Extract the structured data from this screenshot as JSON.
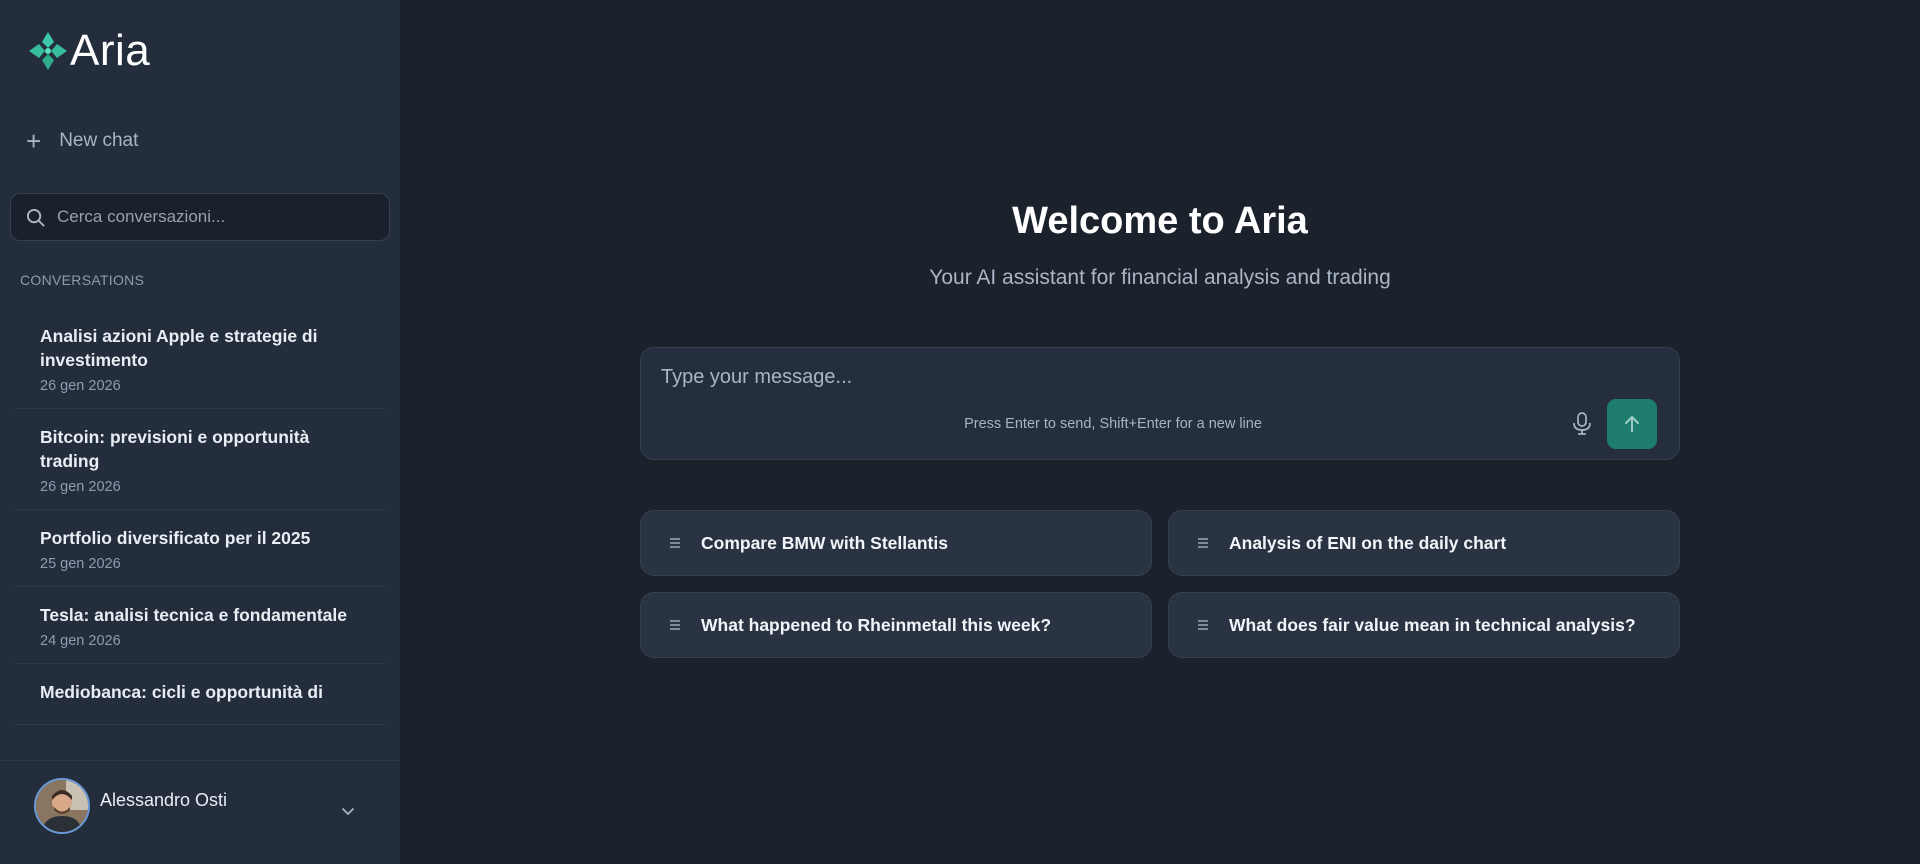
{
  "brand": {
    "name": "Aria",
    "accent": "#3ec7a6"
  },
  "sidebar": {
    "new_chat_label": "New chat",
    "search_placeholder": "Cerca conversazioni...",
    "section_label": "CONVERSATIONS",
    "conversations": [
      {
        "title": "Analisi azioni Apple e strategie di investimento",
        "date": "26 gen 2026"
      },
      {
        "title": "Bitcoin: previsioni e opportunità trading",
        "date": "26 gen 2026"
      },
      {
        "title": "Portfolio diversificato per il 2025",
        "date": "25 gen 2026"
      },
      {
        "title": "Tesla: analisi tecnica e fondamentale",
        "date": "24 gen 2026"
      },
      {
        "title": "Mediobanca: cicli e opportunità di",
        "date": ""
      }
    ],
    "user": {
      "name": "Alessandro Osti"
    }
  },
  "main": {
    "title": "Welcome to Aria",
    "subtitle": "Your AI assistant for financial analysis and trading",
    "composer": {
      "placeholder": "Type your message...",
      "hint": "Press Enter to send, Shift+Enter for a new line"
    },
    "suggestions": [
      "Compare BMW with Stellantis",
      "Analysis of ENI on the daily chart",
      "What happened to Rheinmetall this week?",
      "What does fair value mean in technical analysis?"
    ]
  },
  "colors": {
    "sidebar_bg": "#232d3c",
    "main_bg": "#1c222c",
    "send_button": "#1f7d6f"
  }
}
